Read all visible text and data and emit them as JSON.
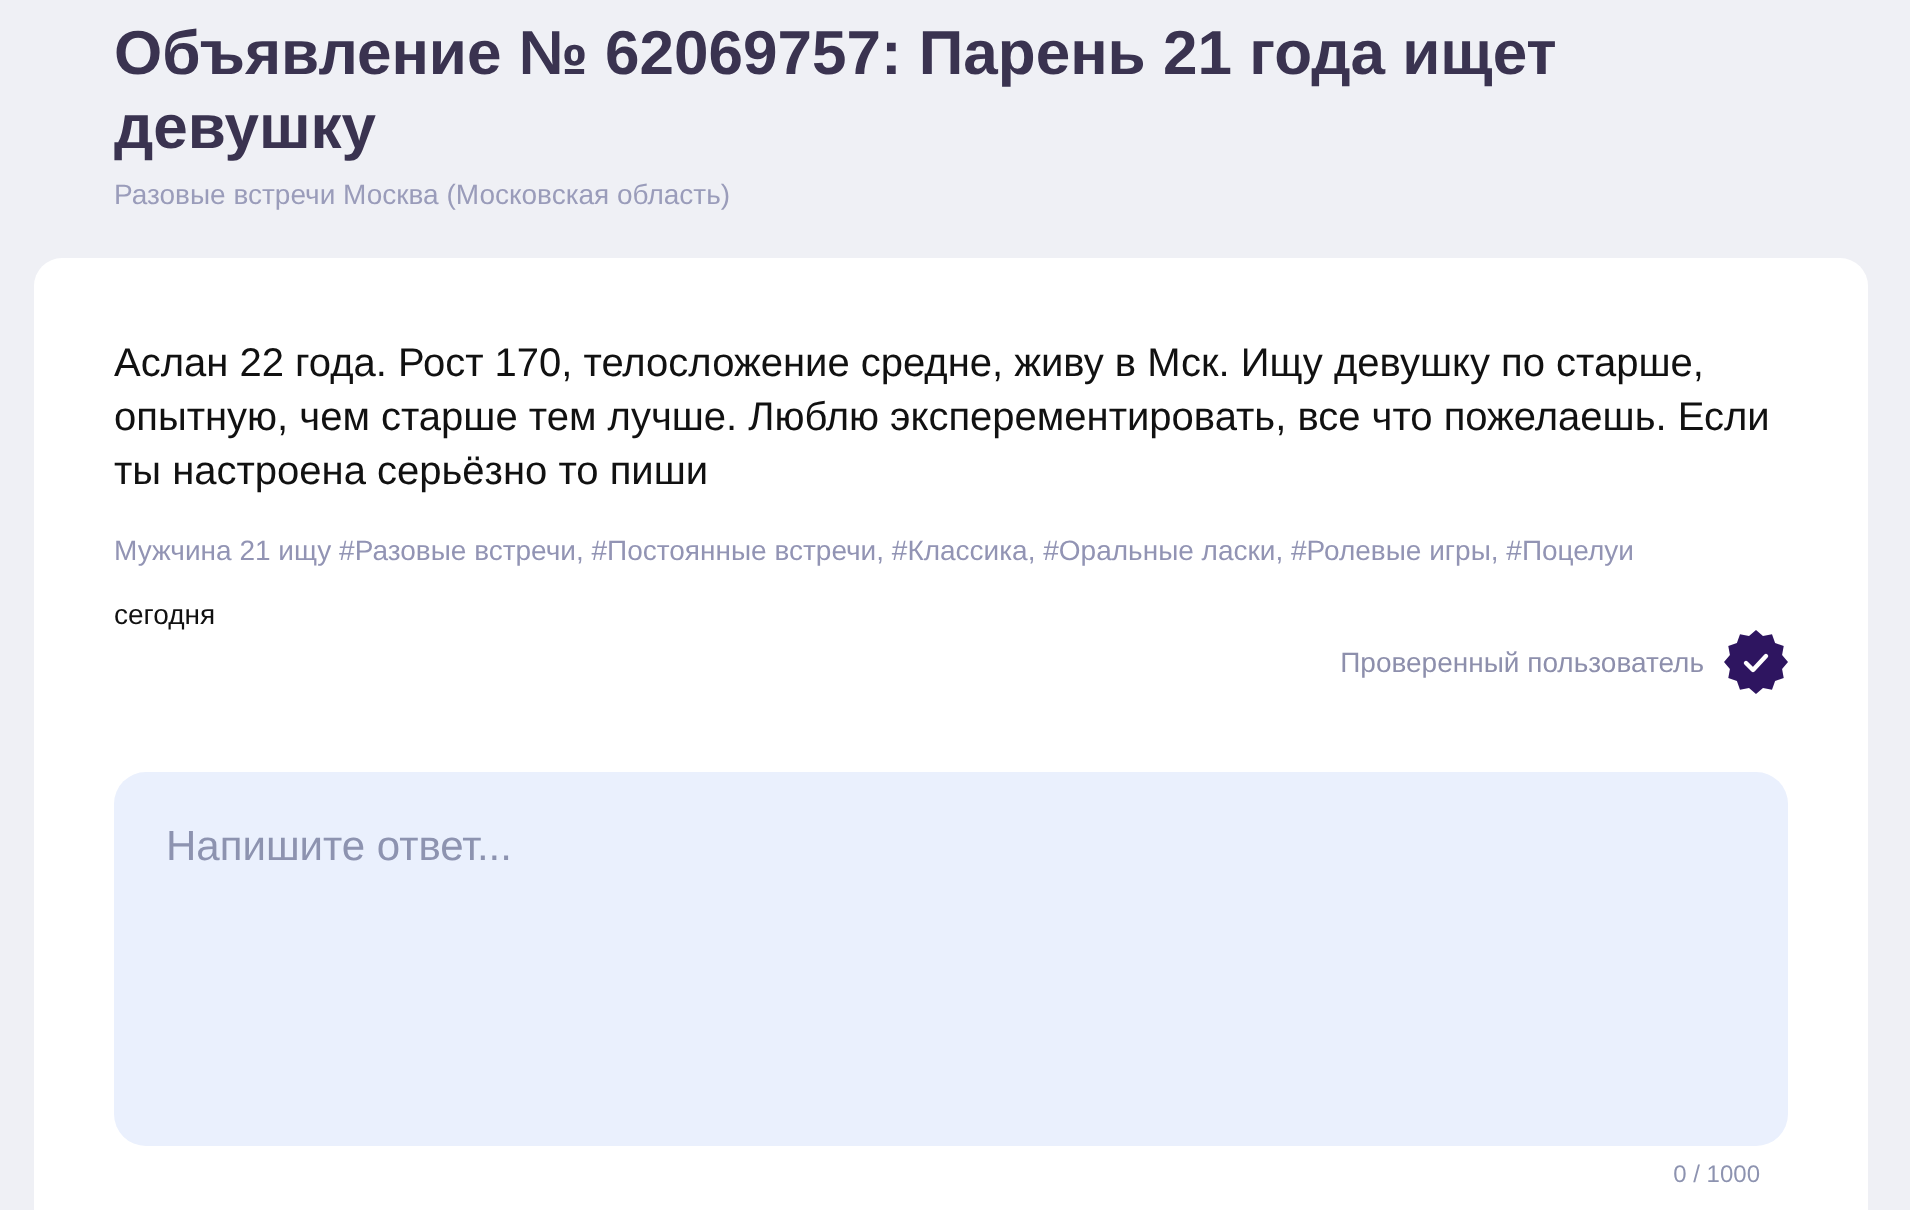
{
  "title": "Объявление № 62069757: Парень 21 года ищет девушку",
  "subtitle": "Разовые встречи Москва (Московская область)",
  "ad": {
    "text": "Аслан 22 года. Рост 170, телосложение средне, живу в Мск. Ищу девушку по старше, опытную, чем старше тем лучше. Люблю эксперементировать, все что пожелаешь. Если ты настроена серьёзно то пиши",
    "tags": "Мужчина 21 ищу #Разовые встречи, #Постоянные встречи, #Классика, #Оральные ласки, #Ролевые игры, #Поцелуи",
    "date": "сегодня",
    "verified": true,
    "verified_label": "Проверенный пользователь"
  },
  "reply": {
    "placeholder": "Напишите ответ...",
    "counter": "0 / 1000"
  }
}
